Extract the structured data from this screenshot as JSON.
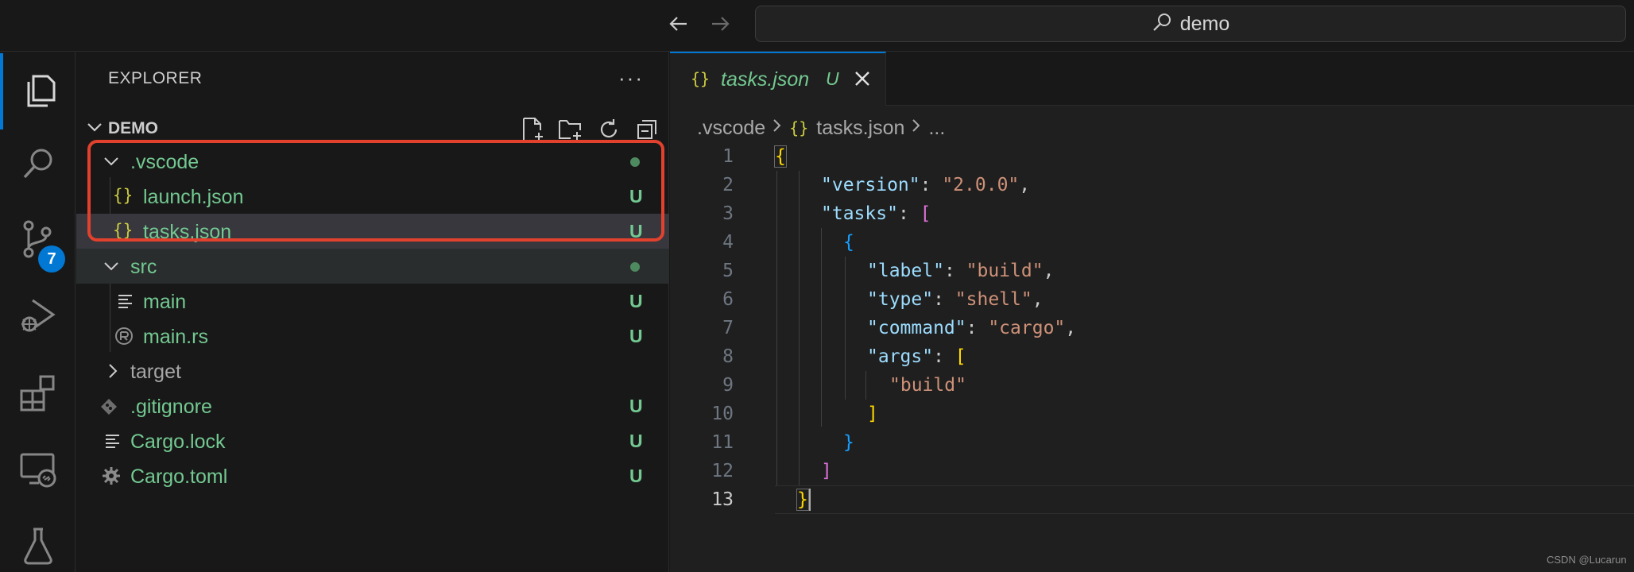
{
  "titlebar": {
    "search_text": "demo"
  },
  "activity_bar": {
    "items": [
      {
        "icon": "files-icon",
        "active": true
      },
      {
        "icon": "search-icon"
      },
      {
        "icon": "source-control-icon",
        "badge": "7"
      },
      {
        "icon": "run-debug-icon"
      },
      {
        "icon": "extensions-icon"
      },
      {
        "icon": "remote-explorer-icon"
      },
      {
        "icon": "testing-icon"
      }
    ]
  },
  "sidebar": {
    "title": "EXPLORER",
    "more": "···",
    "section_title": "DEMO",
    "tree": [
      {
        "label": ".vscode",
        "type": "folder",
        "expanded": true,
        "status": "dot"
      },
      {
        "label": "launch.json",
        "type": "json",
        "status": "U"
      },
      {
        "label": "tasks.json",
        "type": "json",
        "status": "U",
        "selected": true
      },
      {
        "label": "src",
        "type": "folder",
        "expanded": true,
        "status": "dot"
      },
      {
        "label": "main",
        "type": "text",
        "status": "U"
      },
      {
        "label": "main.rs",
        "type": "rust",
        "status": "U"
      },
      {
        "label": "target",
        "type": "folder",
        "expanded": false,
        "status": ""
      },
      {
        "label": ".gitignore",
        "type": "git",
        "status": "U"
      },
      {
        "label": "Cargo.lock",
        "type": "text",
        "status": "U"
      },
      {
        "label": "Cargo.toml",
        "type": "gear",
        "status": "U"
      }
    ]
  },
  "editor": {
    "tab": {
      "icon": "{}",
      "name": "tasks.json",
      "status": "U"
    },
    "breadcrumb": {
      "folder": ".vscode",
      "file_icon": "{}",
      "file": "tasks.json",
      "ellipsis": "..."
    },
    "current_line": 13,
    "lines": [
      {
        "n": "1"
      },
      {
        "n": "2"
      },
      {
        "n": "3"
      },
      {
        "n": "4"
      },
      {
        "n": "5"
      },
      {
        "n": "6"
      },
      {
        "n": "7"
      },
      {
        "n": "8"
      },
      {
        "n": "9"
      },
      {
        "n": "10"
      },
      {
        "n": "11"
      },
      {
        "n": "12"
      },
      {
        "n": "13"
      }
    ],
    "code": {
      "l1_open": "{",
      "l2_key": "\"version\"",
      "l2_colon": ": ",
      "l2_val": "\"2.0.0\"",
      "l2_comma": ",",
      "l3_key": "\"tasks\"",
      "l3_colon": ": ",
      "l3_open": "[",
      "l4_open": "{",
      "l5_key": "\"label\"",
      "l5_colon": ": ",
      "l5_val": "\"build\"",
      "l5_comma": ",",
      "l6_key": "\"type\"",
      "l6_colon": ": ",
      "l6_val": "\"shell\"",
      "l6_comma": ",",
      "l7_key": "\"command\"",
      "l7_colon": ": ",
      "l7_val": "\"cargo\"",
      "l7_comma": ",",
      "l8_key": "\"args\"",
      "l8_colon": ": ",
      "l8_open": "[",
      "l9_val": "\"build\"",
      "l10_close": "]",
      "l11_close": "}",
      "l12_close": "]",
      "l13_close": "}"
    }
  },
  "watermark": "CSDN @Lucarun",
  "colors": {
    "accent": "#0078d4",
    "untracked": "#73c991",
    "highlight_frame": "#e2412d"
  }
}
